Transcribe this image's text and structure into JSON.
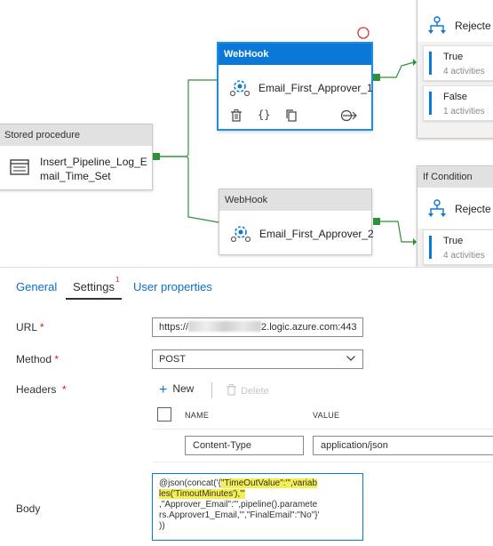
{
  "canvas": {
    "stored_procedure": {
      "header": "Stored procedure",
      "name_line1": "Insert_Pipeline_Log_E",
      "name_line2": "mail_Time_Set"
    },
    "webhook_selected": {
      "header": "WebHook",
      "name": "Email_First_Approver_1"
    },
    "webhook_second": {
      "header": "WebHook",
      "name": "Email_First_Approver_2"
    },
    "if_condition_top": {
      "name": "Rejecte",
      "branches": [
        {
          "title": "True",
          "subtitle": "4 activities"
        },
        {
          "title": "False",
          "subtitle": "1 activities"
        }
      ]
    },
    "if_condition_bottom": {
      "header": "If Condition",
      "name": "Rejecte",
      "branches": [
        {
          "title": "True",
          "subtitle": "4 activities"
        }
      ]
    }
  },
  "tabs": {
    "general": "General",
    "settings": "Settings",
    "settings_badge": "1",
    "user_properties": "User properties"
  },
  "settings": {
    "url_label": "URL",
    "url_value": "https://",
    "url_suffix": "2.logic.azure.com:443",
    "method_label": "Method",
    "method_value": "POST",
    "headers_label": "Headers",
    "required_mark": "*",
    "new_label": "New",
    "delete_label": "Delete",
    "columns": {
      "name": "NAME",
      "value": "VALUE"
    },
    "header_rows": [
      {
        "name": "Content-Type",
        "value": "application/json"
      }
    ],
    "body_label": "Body",
    "body_lines": [
      {
        "pre": "@json(concat('{",
        "hl": "\"TimeOutValue\":'\",variab",
        "post": ""
      },
      {
        "pre": "",
        "hl": "les('TimoutMinutes'),'\"",
        "post": ""
      },
      {
        "pre": ",\"Approver_Email\":\"',pipeline().paramete",
        "hl": "",
        "post": ""
      },
      {
        "pre": "rs.Approver1_Email,'\",\"FinalEmail\":\"No\"}'",
        "hl": "",
        "post": ""
      },
      {
        "pre": "))",
        "hl": "",
        "post": ""
      }
    ]
  },
  "colors": {
    "accent": "#0b78d7",
    "connector": "#2f8f3a",
    "highlight": "#f3ee52",
    "required": "#c5221f"
  },
  "icons": [
    "table-icon",
    "webhook-gear-icon",
    "if-condition-icon",
    "delete-icon",
    "braces-icon",
    "copy-icon",
    "arrow-output-icon",
    "chevron-down-icon",
    "plus-icon"
  ]
}
